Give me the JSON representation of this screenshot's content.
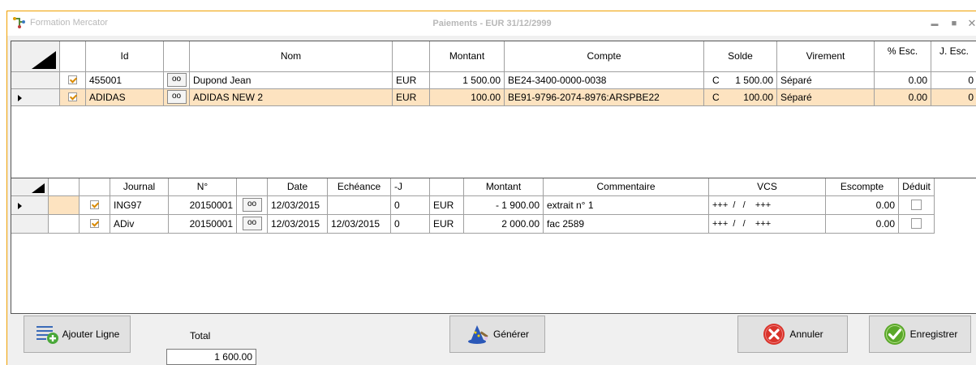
{
  "window": {
    "app_name": "Formation Mercator",
    "title": "Paiements - EUR 31/12/2999",
    "minimize": "▬",
    "maximize": "■",
    "close": "✕"
  },
  "payments_grid": {
    "headers": [
      "Id",
      "Nom",
      "Montant",
      "Compte",
      "Solde",
      "Virement",
      "% Esc.",
      "J. Esc."
    ],
    "rows": [
      {
        "checked": true,
        "id": "455001",
        "nom": "Dupond Jean",
        "devise": "EUR",
        "montant": "1 500.00",
        "compte": "BE24-3400-0000-0038",
        "solde_dc": "C",
        "solde": "1 500.00",
        "virement": "Séparé",
        "pct_esc": "0.00",
        "j_esc": "0",
        "selected": false
      },
      {
        "checked": true,
        "id": "ADIDAS",
        "nom": "ADIDAS NEW 2",
        "devise": "EUR",
        "montant": "100.00",
        "compte": "BE91-9796-2074-8976:ARSPBE22",
        "solde_dc": "C",
        "solde": "100.00",
        "virement": "Séparé",
        "pct_esc": "0.00",
        "j_esc": "0",
        "selected": true
      }
    ]
  },
  "entries_grid": {
    "headers": [
      "Journal",
      "N°",
      "Date",
      "Echéance",
      "-J",
      "Montant",
      "Commentaire",
      "VCS",
      "Escompte",
      "Déduit"
    ],
    "rows": [
      {
        "checked": true,
        "journal": "ING97",
        "numero": "20150001",
        "date": "12/03/2015",
        "echeance": "",
        "j": "0",
        "devise": "EUR",
        "montant": "- 1 900.00",
        "commentaire": "extrait n° 1",
        "vcs": "+++  /   /    +++",
        "escompte": "0.00",
        "deduit": false,
        "current": true
      },
      {
        "checked": true,
        "journal": "ADiv",
        "numero": "20150001",
        "date": "12/03/2015",
        "echeance": "12/03/2015",
        "j": "0",
        "devise": "EUR",
        "montant": "2 000.00",
        "commentaire": "fac 2589",
        "vcs": "+++  /   /    +++",
        "escompte": "0.00",
        "deduit": false,
        "current": false
      }
    ]
  },
  "footer": {
    "add_line_label": "Ajouter Ligne",
    "total_label": "Total",
    "total_value": "1 600.00",
    "generate_label": "Générer",
    "cancel_label": "Annuler",
    "save_label": "Enregistrer"
  },
  "colors": {
    "accent_border": "#f0a000",
    "selected_row": "#fde3c0",
    "cancel_red": "#d9342b",
    "save_green": "#5aa82a"
  }
}
